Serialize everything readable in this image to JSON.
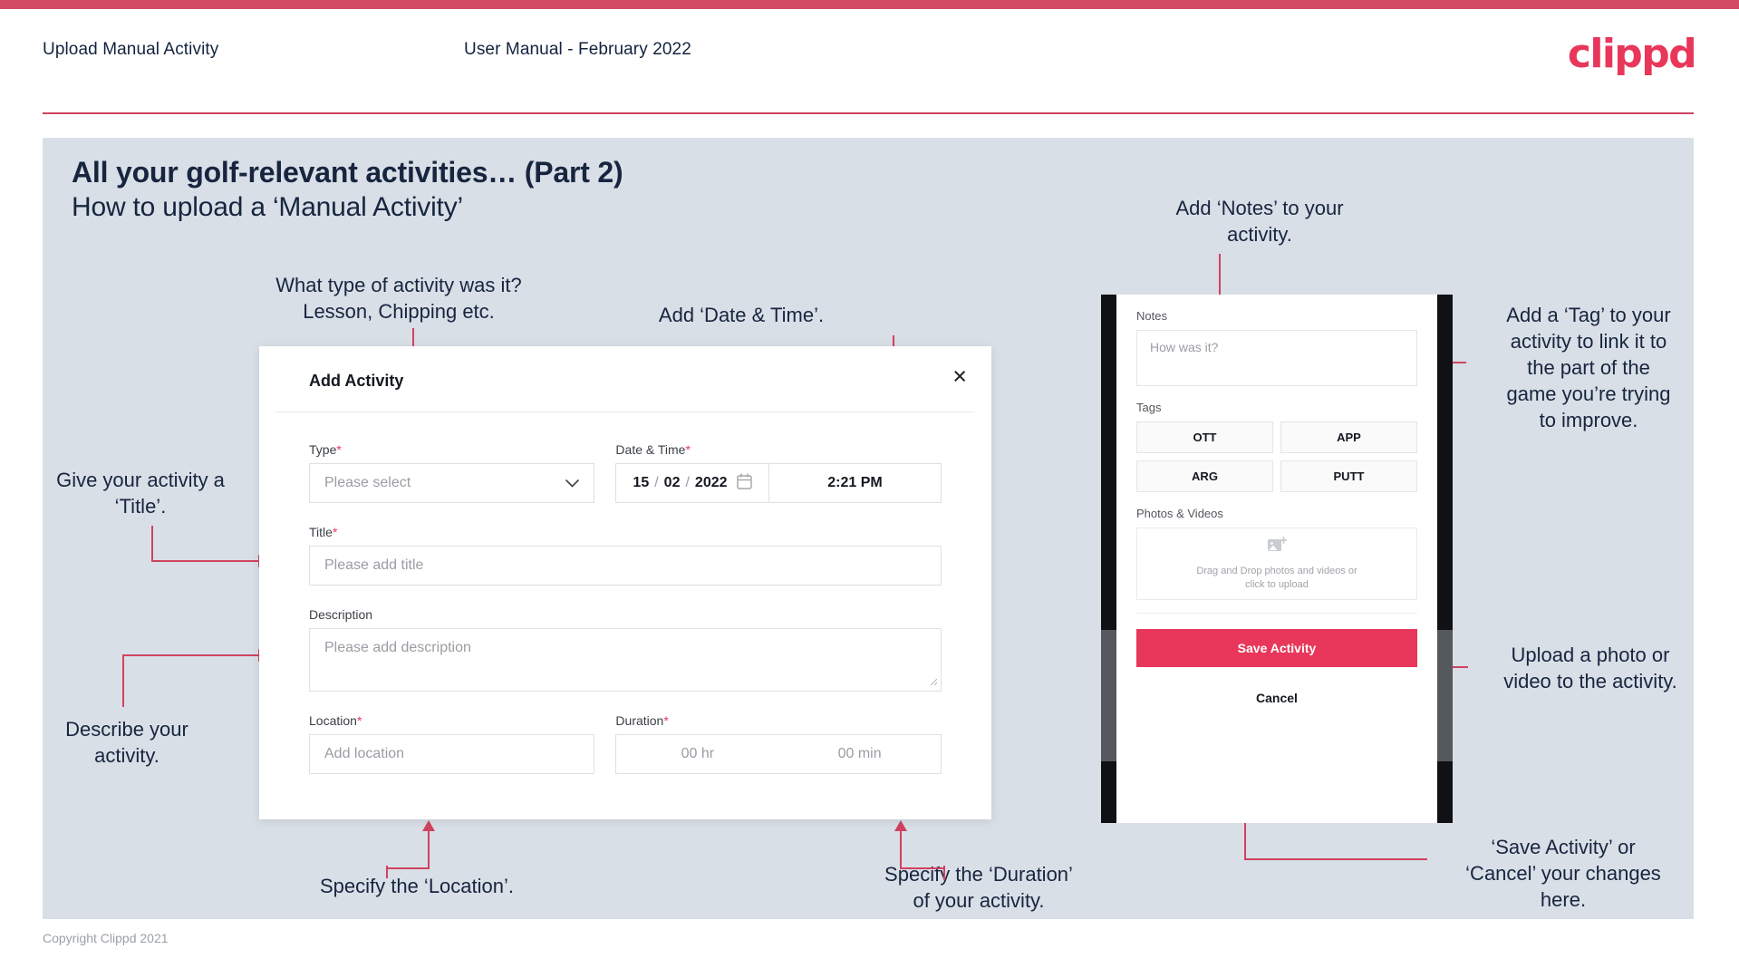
{
  "header": {
    "title": "Upload Manual Activity",
    "subtitle": "User Manual - February 2022",
    "logo": "clippd"
  },
  "slide": {
    "title": "All your golf-relevant activities… (Part 2)",
    "subtitle": "How to upload a ‘Manual Activity’"
  },
  "annotations": {
    "type": "What type of activity was it?\nLesson, Chipping etc.",
    "date_time": "Add ‘Date & Time’.",
    "title": "Give your activity a\n‘Title’.",
    "description": "Describe your\nactivity.",
    "location": "Specify the ‘Location’.",
    "duration": "Specify the ‘Duration’\nof your activity.",
    "notes": "Add ‘Notes’ to your\nactivity.",
    "tags": "Add a ‘Tag’ to your\nactivity to link it to\nthe part of the\ngame you’re trying\nto improve.",
    "upload": "Upload a photo or\nvideo to the activity.",
    "save_cancel": "‘Save Activity’ or\n‘Cancel’ your changes\nhere."
  },
  "dialog": {
    "title": "Add Activity",
    "close_icon": "×",
    "fields": {
      "type": {
        "label": "Type",
        "required": "*",
        "placeholder": "Please select",
        "chevron": "⌄"
      },
      "datetime": {
        "label": "Date & Time",
        "required": "*",
        "day": "15",
        "month": "02",
        "year": "2022",
        "slash": "/",
        "time": "2:21 PM"
      },
      "title": {
        "label": "Title",
        "required": "*",
        "placeholder": "Please add title"
      },
      "description": {
        "label": "Description",
        "required": "",
        "placeholder": "Please add description"
      },
      "location": {
        "label": "Location",
        "required": "*",
        "placeholder": "Add location"
      },
      "duration": {
        "label": "Duration",
        "required": "*",
        "hours_placeholder": "00 hr",
        "minutes_placeholder": "00 min"
      }
    }
  },
  "phone": {
    "notes": {
      "label": "Notes",
      "placeholder": "How was it?"
    },
    "tags": {
      "label": "Tags",
      "items": [
        "OTT",
        "APP",
        "ARG",
        "PUTT"
      ]
    },
    "photos": {
      "label": "Photos & Videos",
      "dropzone_line1": "Drag and Drop photos and videos or",
      "dropzone_line2": "click to upload"
    },
    "save_label": "Save Activity",
    "cancel_label": "Cancel"
  },
  "footer": {
    "copyright": "Copyright Clippd 2021"
  },
  "colors": {
    "brand_pink": "#e8375a",
    "connector_red": "#cf4361",
    "slide_bg": "#d9dfe7",
    "text_dark": "#17253f"
  }
}
